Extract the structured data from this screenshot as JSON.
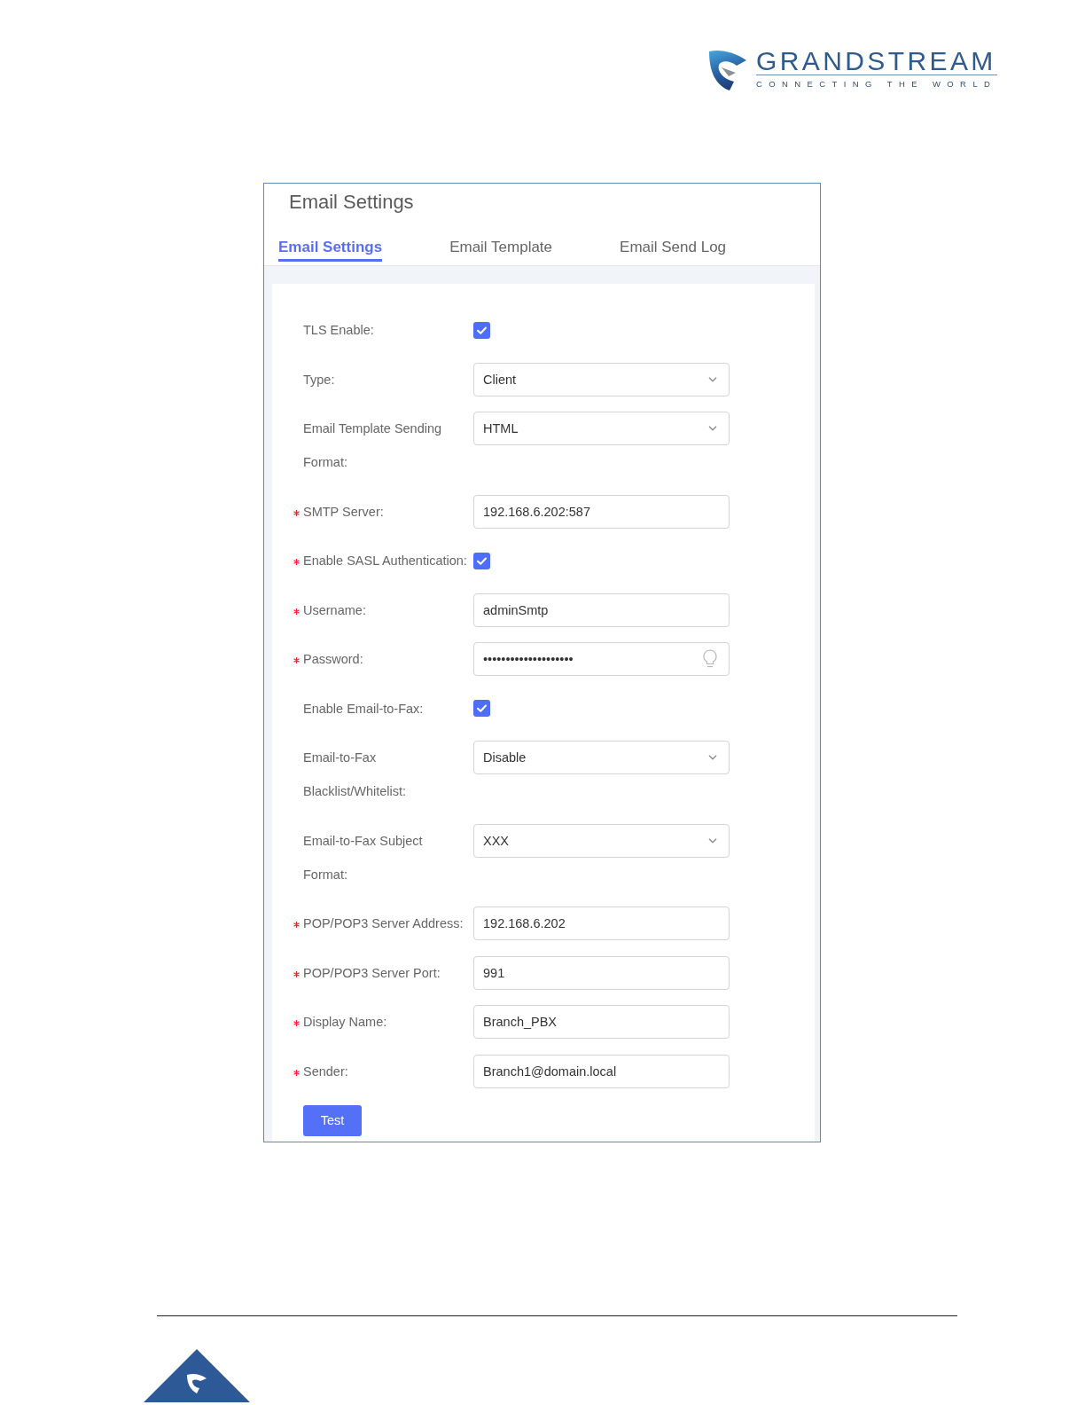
{
  "header": {
    "brand": "GRANDSTREAM",
    "tagline": "CONNECTING THE WORLD"
  },
  "panel": {
    "title": "Email Settings",
    "tabs": [
      {
        "label": "Email Settings",
        "selected": true
      },
      {
        "label": "Email Template",
        "selected": false
      },
      {
        "label": "Email Send Log",
        "selected": false
      }
    ],
    "fields": [
      {
        "kind": "checkbox",
        "label": "TLS Enable:",
        "required": false,
        "checked": true
      },
      {
        "kind": "select",
        "label": "Type:",
        "required": false,
        "value": "Client"
      },
      {
        "kind": "select",
        "label": "Email Template Sending\nFormat:",
        "required": false,
        "value": "HTML"
      },
      {
        "kind": "text",
        "label": "SMTP Server:",
        "required": true,
        "value": "192.168.6.202:587"
      },
      {
        "kind": "checkbox",
        "label": "Enable SASL Authentication:",
        "required": true,
        "checked": true
      },
      {
        "kind": "text",
        "label": "Username:",
        "required": true,
        "value": "adminSmtp"
      },
      {
        "kind": "password",
        "label": "Password:",
        "required": true,
        "value": "••••••••••••••••••••"
      },
      {
        "kind": "checkbox",
        "label": "Enable Email-to-Fax:",
        "required": false,
        "checked": true
      },
      {
        "kind": "select",
        "label": "Email-to-Fax\nBlacklist/Whitelist:",
        "required": false,
        "value": "Disable"
      },
      {
        "kind": "select",
        "label": "Email-to-Fax Subject\nFormat:",
        "required": false,
        "value": "XXX"
      },
      {
        "kind": "text",
        "label": "POP/POP3 Server Address:",
        "required": true,
        "value": "192.168.6.202"
      },
      {
        "kind": "text",
        "label": "POP/POP3 Server Port:",
        "required": true,
        "value": "991"
      },
      {
        "kind": "text",
        "label": "Display Name:",
        "required": true,
        "value": "Branch_PBX"
      },
      {
        "kind": "text",
        "label": "Sender:",
        "required": true,
        "value": "Branch1@domain.local"
      }
    ],
    "buttons": [
      {
        "label": "Test"
      }
    ]
  }
}
